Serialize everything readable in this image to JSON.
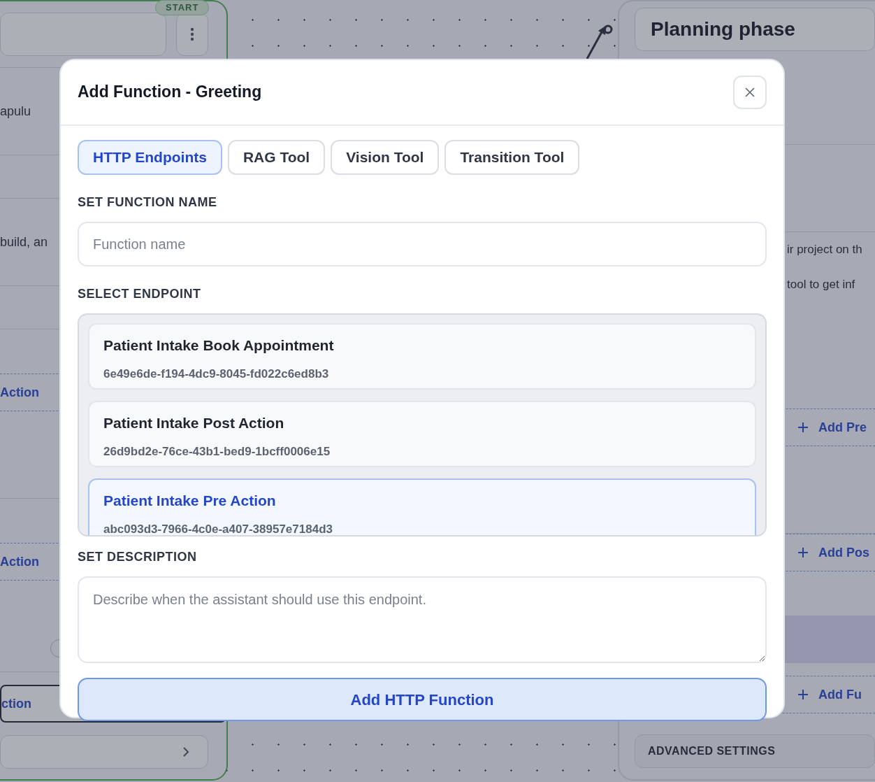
{
  "canvas": {
    "start_node": {
      "badge": "START",
      "rows": [
        {
          "kind": "header"
        },
        {
          "kind": "text",
          "text": "apulu"
        },
        {
          "kind": "empty"
        },
        {
          "kind": "text",
          "text": "build, an"
        },
        {
          "kind": "empty"
        },
        {
          "kind": "add",
          "text": "Action"
        },
        {
          "kind": "empty"
        },
        {
          "kind": "add",
          "text": "Action"
        },
        {
          "kind": "toggle"
        },
        {
          "kind": "selected",
          "text": "ction"
        },
        {
          "kind": "nav"
        }
      ]
    },
    "phase_node": {
      "rows": [
        {
          "kind": "title",
          "text": "Planning phase"
        },
        {
          "kind": "empty"
        },
        {
          "kind": "empty"
        },
        {
          "kind": "text",
          "text": "ir project on th"
        },
        {
          "kind": "text",
          "text": "tool to get inf"
        },
        {
          "kind": "add",
          "text": "Add Pre"
        },
        {
          "kind": "empty"
        },
        {
          "kind": "add",
          "text": "Add Pos"
        },
        {
          "kind": "band"
        },
        {
          "kind": "add",
          "text": "Add Fu"
        },
        {
          "kind": "settings",
          "text": "ADVANCED SETTINGS"
        }
      ]
    }
  },
  "modal": {
    "title": "Add Function - Greeting",
    "tabs": [
      {
        "label": "HTTP Endpoints",
        "selected": true
      },
      {
        "label": "RAG Tool",
        "selected": false
      },
      {
        "label": "Vision Tool",
        "selected": false
      },
      {
        "label": "Transition Tool",
        "selected": false
      }
    ],
    "name_label": "SET FUNCTION NAME",
    "name_field": {
      "placeholder": "Function name"
    },
    "endpoint_label": "SELECT ENDPOINT",
    "endpoints": [
      {
        "name": "Patient Intake Book Appointment",
        "id": "6e49e6de-f194-4dc9-8045-fd022c6ed8b3",
        "selected": false
      },
      {
        "name": "Patient Intake Post Action",
        "id": "26d9bd2e-76ce-43b1-bed9-1bcff0006e15",
        "selected": false
      },
      {
        "name": "Patient Intake Pre Action",
        "id": "abc093d3-7966-4c0e-a407-38957e7184d3",
        "selected": true
      }
    ],
    "description_label": "SET DESCRIPTION",
    "description_field": {
      "placeholder": "Describe when the assistant should use this endpoint."
    },
    "submit": "Add HTTP Function"
  }
}
